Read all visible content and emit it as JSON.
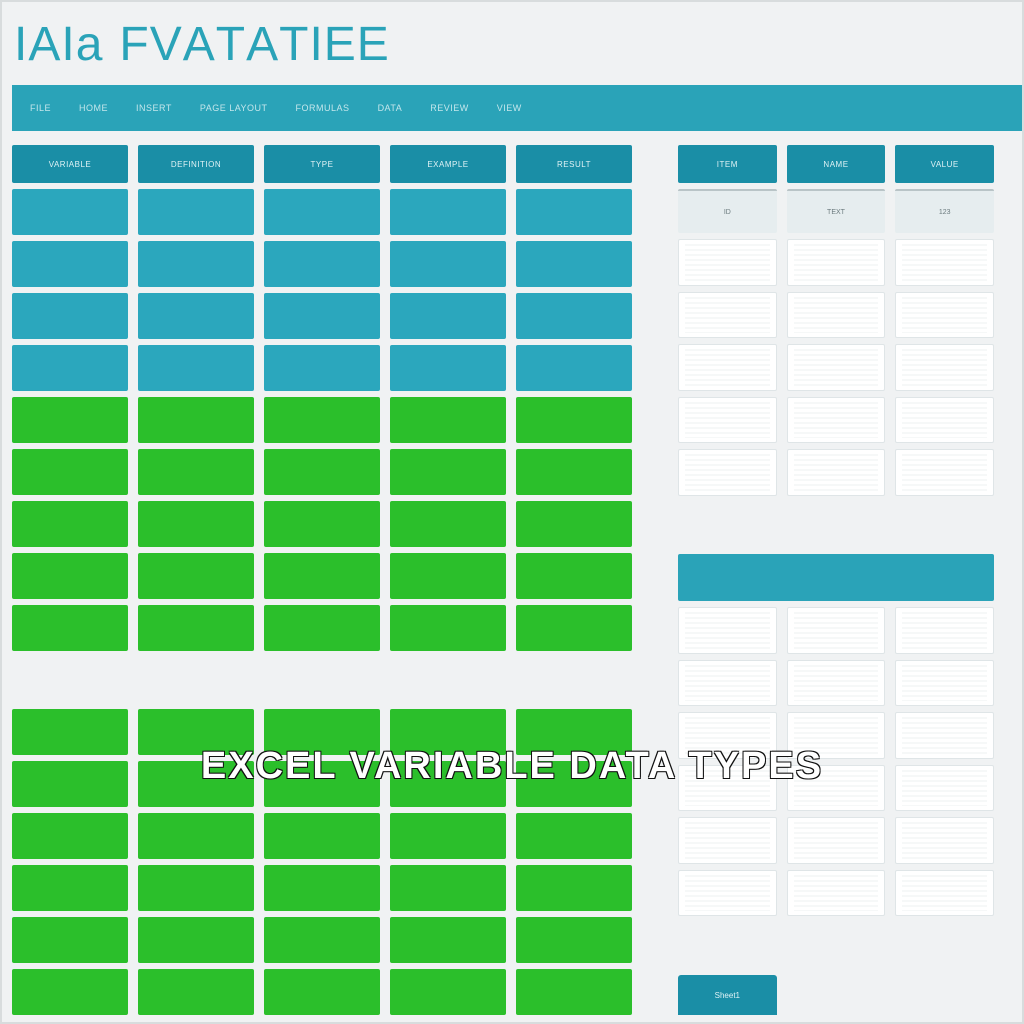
{
  "title_glyphs": [
    "I",
    "A",
    "I",
    "a",
    "F",
    "V",
    "A",
    "T",
    "A",
    "T",
    "I",
    "E",
    "E"
  ],
  "ribbon_tabs": [
    "FILE",
    "HOME",
    "INSERT",
    "PAGE LAYOUT",
    "FORMULAS",
    "DATA",
    "REVIEW",
    "VIEW"
  ],
  "left_headers": [
    "VARIABLE",
    "DEFINITION",
    "TYPE",
    "EXAMPLE",
    "RESULT"
  ],
  "right_headers": [
    "ITEM",
    "NAME",
    "VALUE"
  ],
  "right_sub": [
    "ID",
    "TEXT",
    "123"
  ],
  "footer_tabs": [
    "Sheet1"
  ],
  "caption": "EXCEL VARIABLE DATA TYPES",
  "row_bands": {
    "teal_rows": 4,
    "green_rows_1": 5,
    "break": 1,
    "green_rows_2": 6
  }
}
